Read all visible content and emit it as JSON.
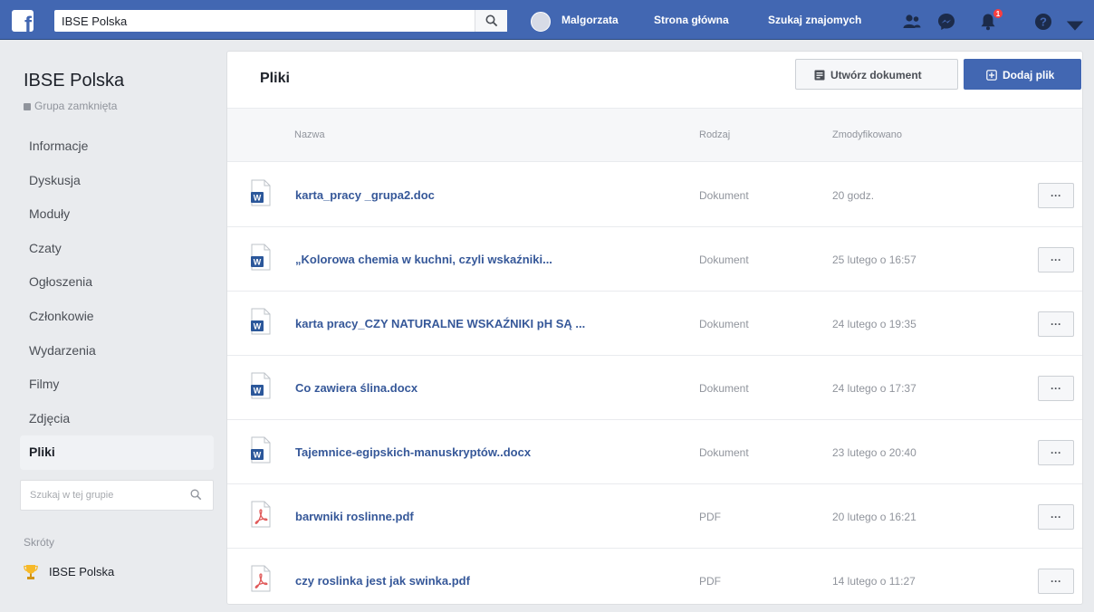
{
  "colors": {
    "brand": "#4267b2",
    "link": "#365899",
    "notification": "#fa3e3e",
    "pdf": "#e05a5a",
    "word": "#2b579a"
  },
  "topbar": {
    "logo_icon": "facebook-f-icon",
    "search_value": "IBSE Polska",
    "user_name": "Malgorzata",
    "home_label": "Strona główna",
    "find_friends_label": "Szukaj znajomych",
    "notification_count": "1",
    "icons": [
      "friends-icon",
      "messenger-icon",
      "notifications-icon",
      "help-icon",
      "caret-down-icon"
    ]
  },
  "group": {
    "name": "IBSE Polska",
    "privacy": "Grupa zamknięta"
  },
  "sidebar": {
    "items": [
      {
        "label": "Informacje",
        "active": false
      },
      {
        "label": "Dyskusja",
        "active": false
      },
      {
        "label": "Moduły",
        "active": false
      },
      {
        "label": "Czaty",
        "active": false
      },
      {
        "label": "Ogłoszenia",
        "active": false
      },
      {
        "label": "Członkowie",
        "active": false
      },
      {
        "label": "Wydarzenia",
        "active": false
      },
      {
        "label": "Filmy",
        "active": false
      },
      {
        "label": "Zdjęcia",
        "active": false
      },
      {
        "label": "Pliki",
        "active": true
      }
    ],
    "search_placeholder": "Szukaj w tej grupie",
    "shortcuts_label": "Skróty",
    "shortcut": "IBSE Polska"
  },
  "main": {
    "title": "Pliki",
    "create_doc_label": "Utwórz dokument",
    "add_file_label": "Dodaj plik",
    "columns": {
      "name": "Nazwa",
      "type": "Rodzaj",
      "modified": "Zmodyfikowano"
    },
    "more_label": "···",
    "files": [
      {
        "name": "karta_pracy _grupa2.doc",
        "type": "Dokument",
        "modified": "20 godz.",
        "icon": "word"
      },
      {
        "name": "„Kolorowa chemia w kuchni, czyli wskaźniki...",
        "type": "Dokument",
        "modified": "25 lutego o 16:57",
        "icon": "word"
      },
      {
        "name": "karta pracy_CZY NATURALNE WSKAŹNIKI pH SĄ ...",
        "type": "Dokument",
        "modified": "24 lutego o 19:35",
        "icon": "word"
      },
      {
        "name": "Co zawiera ślina.docx",
        "type": "Dokument",
        "modified": "24 lutego o 17:37",
        "icon": "word"
      },
      {
        "name": "Tajemnice-egipskich-manuskryptów..docx",
        "type": "Dokument",
        "modified": "23 lutego o 20:40",
        "icon": "word"
      },
      {
        "name": "barwniki roslinne.pdf",
        "type": "PDF",
        "modified": "20 lutego o 16:21",
        "icon": "pdf"
      },
      {
        "name": "czy roslinka jest jak swinka.pdf",
        "type": "PDF",
        "modified": "14 lutego o 11:27",
        "icon": "pdf"
      }
    ]
  }
}
